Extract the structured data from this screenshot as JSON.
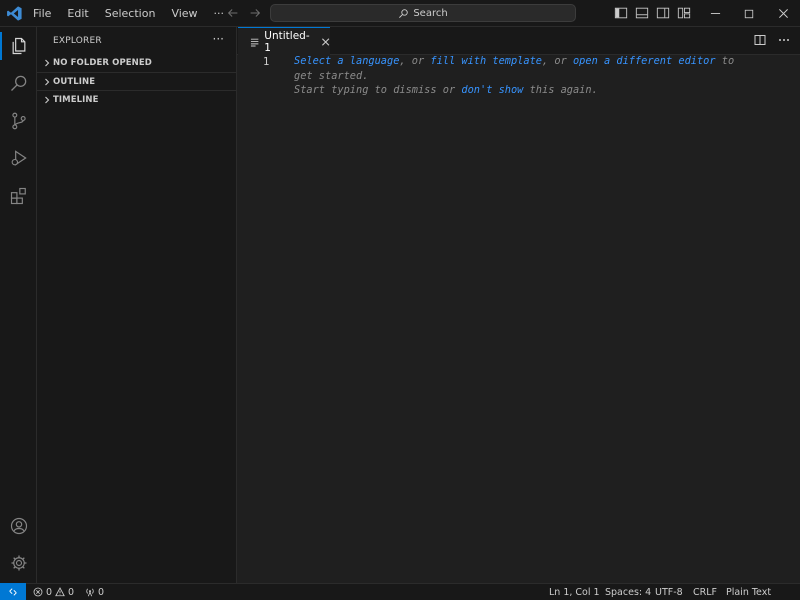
{
  "titlebar": {
    "menu": [
      "File",
      "Edit",
      "Selection",
      "View",
      "···"
    ],
    "search_label": "Search"
  },
  "sidebar": {
    "title": "EXPLORER",
    "more": "···",
    "sections": [
      "NO FOLDER OPENED",
      "OUTLINE",
      "TIMELINE"
    ]
  },
  "editor": {
    "tab_name": "Untitled-1",
    "line_number": "1",
    "hint": {
      "select_language": "Select a language",
      "or1": ", or ",
      "fill_template": "fill with template",
      "or2": ", or ",
      "open_editor": "open a different editor",
      "to": " to",
      "get_started": "get started.",
      "start_typing": "Start typing to dismiss or ",
      "dont_show": "don't show",
      "this_again": " this again."
    }
  },
  "statusbar": {
    "errors": "0",
    "warnings": "0",
    "ports": "0",
    "position": "Ln 1, Col 1",
    "spaces": "Spaces: 4",
    "encoding": "UTF-8",
    "eol": "CRLF",
    "language": "Plain Text"
  },
  "colors": {
    "accent": "#0078d4",
    "link": "#3794ff",
    "background": "#1f1f1f",
    "chrome": "#181818"
  }
}
